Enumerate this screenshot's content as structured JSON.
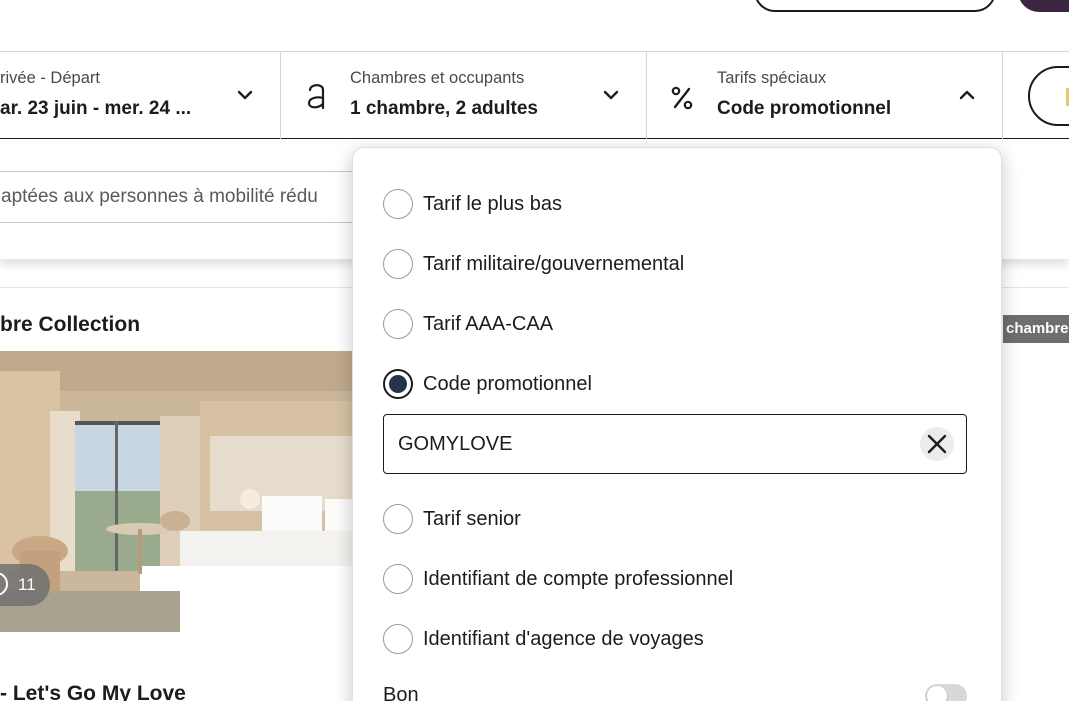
{
  "header": {
    "account_button": "",
    "primary_button": ""
  },
  "search": {
    "dates": {
      "label": "rivée - Départ",
      "value": "ar. 23 juin - mer. 24 ..."
    },
    "rooms": {
      "label": "Chambres et occupants",
      "value": "1 chambre, 2 adultes"
    },
    "rates": {
      "label": "Tarifs spéciaux",
      "value": "Code promotionnel"
    }
  },
  "filters": {
    "accessible_text": "aptées aux personnes à mobilité rédu"
  },
  "results": {
    "hotel_name": "bre Collection",
    "room_badge": "chambre",
    "photo_count": "11",
    "offer_title": "- Let's Go My Love"
  },
  "special_rates": {
    "options": [
      {
        "label": "Tarif le plus bas",
        "checked": false
      },
      {
        "label": "Tarif militaire/gouvernemental",
        "checked": false
      },
      {
        "label": "Tarif AAA-CAA",
        "checked": false
      },
      {
        "label": "Code promotionnel",
        "checked": true
      },
      {
        "label": "Tarif senior",
        "checked": false
      },
      {
        "label": "Identifiant de compte professionnel",
        "checked": false
      },
      {
        "label": "Identifiant d'agence de voyages",
        "checked": false
      }
    ],
    "promo_code_value": "GOMYLOVE",
    "voucher_label": "Bon",
    "voucher_enabled": false
  },
  "colors": {
    "accent_dark": "#26334a",
    "brand_purple": "#3b2540",
    "badge_gray": "#6e6e6e"
  }
}
